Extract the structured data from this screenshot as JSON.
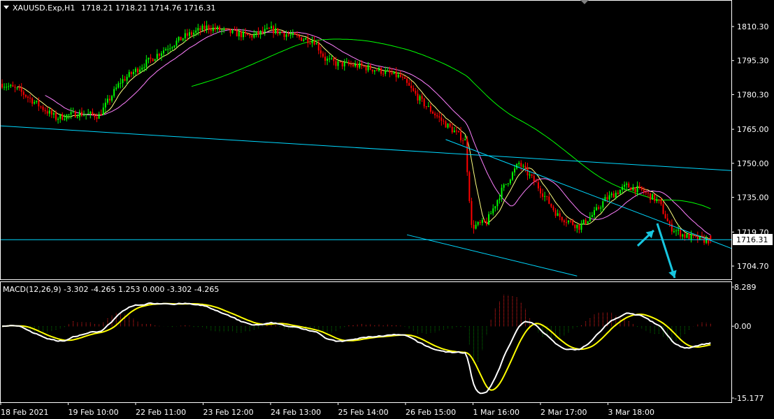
{
  "main_header": {
    "symbol_tf": "XAUUSD.Exp,H1",
    "ohlc": "1718.21 1718.21 1714.76 1716.31"
  },
  "macd_header": {
    "text": "MACD(12,26,9) -3.302 -4.265 1.253 0.000 -3.302 -4.265"
  },
  "colors": {
    "background": "#000000",
    "frame": "#ffffff",
    "bull_candle": "#00ff00",
    "bear_candle": "#ff0000",
    "ma_fast": "#ffff80",
    "ma_mid": "#ff80ff",
    "ma_slow": "#00ff00",
    "trendline": "#00d8ff",
    "macd_line": "#ffffff",
    "signal_line": "#ffff00",
    "hist_pos": "#ff2020",
    "hist_neg": "#008000",
    "arrow": "#17c6e0"
  },
  "chart_data": [
    {
      "type": "candlestick",
      "name": "price",
      "yaxis_ticks": [
        "1810.30",
        "1795.30",
        "1780.30",
        "1765.00",
        "1750.00",
        "1735.00",
        "1719.70",
        "1704.70"
      ],
      "ylim": [
        1698.5,
        1823.5
      ],
      "current_price": "1716.31",
      "xaxis_ticks": [
        "18 Feb 2021",
        "19 Feb 10:00",
        "22 Feb 11:00",
        "23 Feb 12:00",
        "24 Feb 13:00",
        "25 Feb 14:00",
        "26 Feb 15:00",
        "1 Mar 16:00",
        "2 Mar 17:00",
        "3 Mar 18:00"
      ],
      "close_path": [
        [
          0,
          1785
        ],
        [
          8,
          1782
        ],
        [
          15,
          1777
        ],
        [
          25,
          1770
        ],
        [
          35,
          1772
        ],
        [
          45,
          1771
        ],
        [
          55,
          1786
        ],
        [
          65,
          1793
        ],
        [
          75,
          1800
        ],
        [
          85,
          1806
        ],
        [
          95,
          1810
        ],
        [
          105,
          1808
        ],
        [
          115,
          1806
        ],
        [
          125,
          1809
        ],
        [
          135,
          1806
        ],
        [
          145,
          1804
        ],
        [
          150,
          1796
        ],
        [
          155,
          1794
        ],
        [
          165,
          1793
        ],
        [
          175,
          1791
        ],
        [
          185,
          1788
        ],
        [
          195,
          1777
        ],
        [
          205,
          1768
        ],
        [
          215,
          1760
        ],
        [
          218,
          1722
        ],
        [
          225,
          1724
        ],
        [
          232,
          1738
        ],
        [
          240,
          1750
        ],
        [
          248,
          1741
        ],
        [
          258,
          1727
        ],
        [
          268,
          1722
        ],
        [
          275,
          1728
        ],
        [
          280,
          1734
        ],
        [
          290,
          1740
        ],
        [
          297,
          1738
        ],
        [
          305,
          1733
        ],
        [
          310,
          1722
        ],
        [
          317,
          1718
        ],
        [
          327,
          1716
        ]
      ],
      "moving_averages": [
        {
          "color_key": "ma_fast",
          "period": 8
        },
        {
          "color_key": "ma_mid",
          "period": 21
        },
        {
          "color_key": "ma_slow",
          "period": 89
        }
      ]
    },
    {
      "type": "macd",
      "name": "MACD(12,26,9)",
      "yaxis_ticks": [
        "8.289",
        "0.00",
        "-15.177"
      ],
      "ylim": [
        -15.177,
        8.289
      ]
    }
  ]
}
